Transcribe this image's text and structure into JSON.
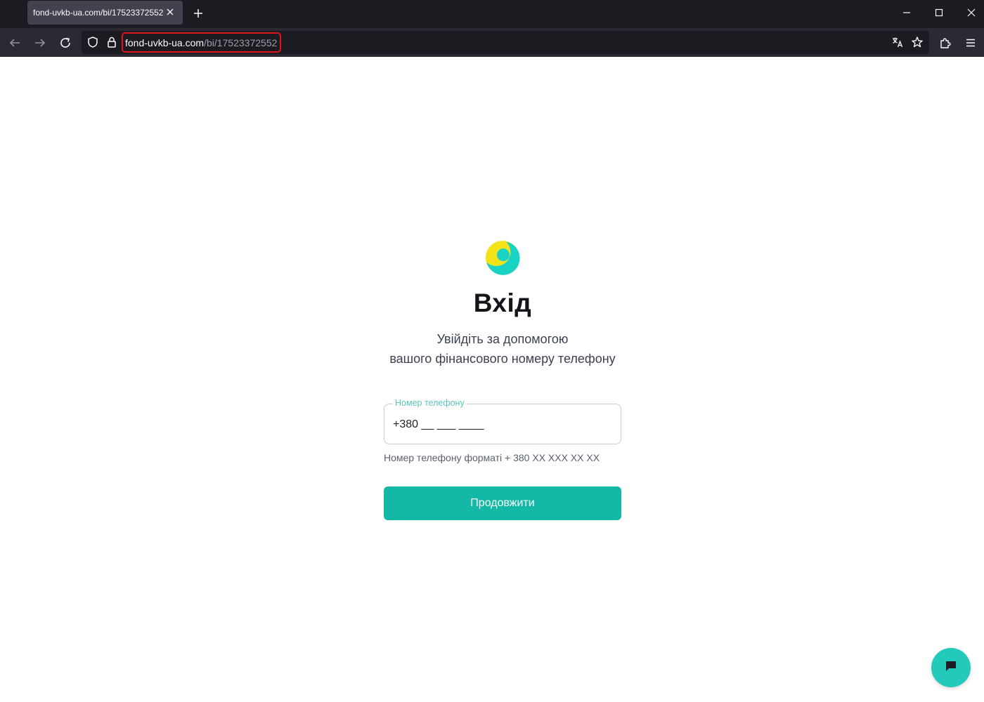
{
  "browser": {
    "tab": {
      "title": "fond-uvkb-ua.com/bi/17523372552"
    },
    "address": {
      "host": "fond-uvkb-ua.com",
      "path": "/bi/17523372552"
    }
  },
  "icons": {
    "back": "arrow-left-icon",
    "forward": "arrow-right-icon",
    "reload": "reload-icon",
    "shield": "shield-icon",
    "lock": "lock-icon",
    "translate": "translate-icon",
    "bookmark": "star-icon",
    "extensions": "puzzle-icon",
    "menu": "hamburger-icon",
    "chat": "chat-bubble-icon"
  },
  "login": {
    "title": "Вхід",
    "subtitle_line1": "Увійдіть за допомогою",
    "subtitle_line2": "вашого фінансового номеру телефону",
    "phone_label": "Номер телефону",
    "phone_value": "+380 __ ___ ____",
    "hint": "Номер телефону форматі + 380 XX XXX XX XX",
    "continue_label": "Продовжити"
  },
  "colors": {
    "accent": "#14b8a6",
    "chat": "#23c9bb",
    "logo_yellow": "#f5e31a",
    "logo_teal": "#19d3c5",
    "url_highlight": "#e0141b"
  }
}
